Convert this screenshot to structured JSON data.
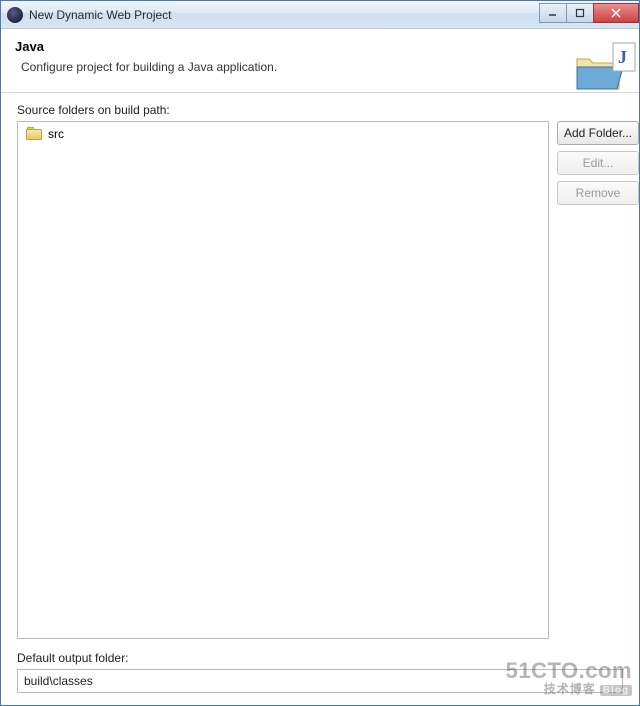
{
  "window": {
    "title": "New Dynamic Web Project"
  },
  "header": {
    "title": "Java",
    "description": "Configure project for building a Java application."
  },
  "source": {
    "label": "Source folders on build path:",
    "items": [
      {
        "name": "src"
      }
    ],
    "buttons": {
      "add": "Add Folder...",
      "edit": "Edit...",
      "remove": "Remove"
    }
  },
  "output": {
    "label": "Default output folder:",
    "value": "build\\classes"
  },
  "watermark": {
    "line1": "51CTO.com",
    "line2": "技术博客",
    "tag": "Blog"
  }
}
